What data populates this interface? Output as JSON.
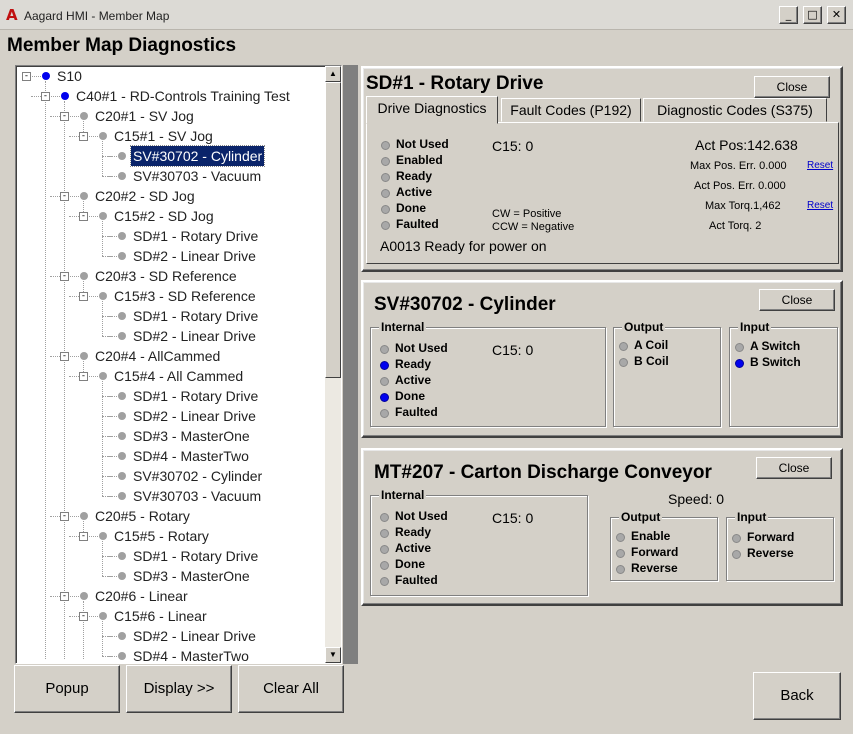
{
  "window": {
    "title": "Aagard HMI - Member Map",
    "icon": "app-a-icon",
    "min": "_",
    "max": "□",
    "close": "✕"
  },
  "page_title": "Member Map Diagnostics",
  "tree": [
    {
      "label": "S10",
      "level": 0,
      "dot": "blue",
      "expander": "-"
    },
    {
      "label": "C40#1 - RD-Controls Training Test",
      "level": 1,
      "dot": "blue",
      "expander": "-"
    },
    {
      "label": "C20#1 - SV Jog",
      "level": 2,
      "dot": "gray",
      "expander": "-"
    },
    {
      "label": "C15#1 - SV Jog",
      "level": 3,
      "dot": "gray",
      "expander": "-"
    },
    {
      "label": "SV#30702 - Cylinder",
      "level": 4,
      "dot": "gray",
      "selected": true
    },
    {
      "label": "SV#30703 - Vacuum",
      "level": 4,
      "dot": "gray"
    },
    {
      "label": "C20#2 - SD Jog",
      "level": 2,
      "dot": "gray",
      "expander": "-"
    },
    {
      "label": "C15#2 - SD Jog",
      "level": 3,
      "dot": "gray",
      "expander": "-"
    },
    {
      "label": "SD#1 - Rotary Drive",
      "level": 4,
      "dot": "gray"
    },
    {
      "label": "SD#2 - Linear Drive",
      "level": 4,
      "dot": "gray"
    },
    {
      "label": "C20#3 - SD Reference",
      "level": 2,
      "dot": "gray",
      "expander": "-"
    },
    {
      "label": "C15#3 - SD Reference",
      "level": 3,
      "dot": "gray",
      "expander": "-"
    },
    {
      "label": "SD#1 - Rotary Drive",
      "level": 4,
      "dot": "gray"
    },
    {
      "label": "SD#2 - Linear Drive",
      "level": 4,
      "dot": "gray"
    },
    {
      "label": "C20#4 - AllCammed",
      "level": 2,
      "dot": "gray",
      "expander": "-"
    },
    {
      "label": "C15#4 - All Cammed",
      "level": 3,
      "dot": "gray",
      "expander": "-"
    },
    {
      "label": "SD#1 - Rotary Drive",
      "level": 4,
      "dot": "gray"
    },
    {
      "label": "SD#2 - Linear Drive",
      "level": 4,
      "dot": "gray"
    },
    {
      "label": "SD#3 - MasterOne",
      "level": 4,
      "dot": "gray"
    },
    {
      "label": "SD#4 - MasterTwo",
      "level": 4,
      "dot": "gray"
    },
    {
      "label": "SV#30702 - Cylinder",
      "level": 4,
      "dot": "gray"
    },
    {
      "label": "SV#30703 - Vacuum",
      "level": 4,
      "dot": "gray"
    },
    {
      "label": "C20#5 - Rotary",
      "level": 2,
      "dot": "gray",
      "expander": "-"
    },
    {
      "label": "C15#5 - Rotary",
      "level": 3,
      "dot": "gray",
      "expander": "-"
    },
    {
      "label": "SD#1 - Rotary Drive",
      "level": 4,
      "dot": "gray"
    },
    {
      "label": "SD#3 - MasterOne",
      "level": 4,
      "dot": "gray"
    },
    {
      "label": "C20#6 - Linear",
      "level": 2,
      "dot": "gray",
      "expander": "-"
    },
    {
      "label": "C15#6 - Linear",
      "level": 3,
      "dot": "gray",
      "expander": "-"
    },
    {
      "label": "SD#2 - Linear Drive",
      "level": 4,
      "dot": "gray"
    },
    {
      "label": "SD#4 - MasterTwo",
      "level": 4,
      "dot": "gray"
    }
  ],
  "scroll": {
    "up": "▲",
    "down": "▼"
  },
  "buttons": {
    "popup": "Popup",
    "display": "Display >>",
    "clear_all": "Clear All",
    "back": "Back"
  },
  "sd_panel": {
    "title": "SD#1 - Rotary Drive",
    "close": "Close",
    "tabs": [
      "Drive Diagnostics",
      "Fault Codes (P192)",
      "Diagnostic Codes (S375)"
    ],
    "active_tab": 0,
    "status": [
      {
        "label": "Not Used",
        "on": false
      },
      {
        "label": "Enabled",
        "on": false
      },
      {
        "label": "Ready",
        "on": false
      },
      {
        "label": "Active",
        "on": false
      },
      {
        "label": "Done",
        "on": false
      },
      {
        "label": "Faulted",
        "on": false
      }
    ],
    "c15": "C15:  0",
    "cw": "CW = Positive",
    "ccw": "CCW = Negative",
    "message": "A0013 Ready for power on",
    "act_pos": "Act Pos:142.638",
    "max_pos_err": "Max Pos. Err. 0.000",
    "act_pos_err": "Act Pos. Err. 0.000",
    "max_torq": "Max Torq.1,462",
    "act_torq": "Act Torq. 2",
    "reset": "Reset"
  },
  "sv_panel": {
    "title": "SV#30702 - Cylinder",
    "close": "Close",
    "internal_label": "Internal",
    "internal": [
      {
        "label": "Not Used",
        "on": false
      },
      {
        "label": "Ready",
        "on": true
      },
      {
        "label": "Active",
        "on": false
      },
      {
        "label": "Done",
        "on": true
      },
      {
        "label": "Faulted",
        "on": false
      }
    ],
    "c15": "C15:  0",
    "output_label": "Output",
    "outputs": [
      {
        "label": "A Coil",
        "on": false
      },
      {
        "label": "B Coil",
        "on": false
      }
    ],
    "input_label": "Input",
    "inputs": [
      {
        "label": "A Switch",
        "on": false
      },
      {
        "label": "B Switch",
        "on": true
      }
    ]
  },
  "mt_panel": {
    "title": "MT#207 - Carton Discharge Conveyor",
    "close": "Close",
    "internal_label": "Internal",
    "internal": [
      {
        "label": "Not Used",
        "on": false
      },
      {
        "label": "Ready",
        "on": false
      },
      {
        "label": "Active",
        "on": false
      },
      {
        "label": "Done",
        "on": false
      },
      {
        "label": "Faulted",
        "on": false
      }
    ],
    "c15": "C15:  0",
    "speed": "Speed:  0",
    "output_label": "Output",
    "outputs": [
      {
        "label": "Enable",
        "on": false
      },
      {
        "label": "Forward",
        "on": false
      },
      {
        "label": "Reverse",
        "on": false
      }
    ],
    "input_label": "Input",
    "inputs": [
      {
        "label": "Forward",
        "on": false
      },
      {
        "label": "Reverse",
        "on": false
      }
    ]
  },
  "colors": {
    "led_on": "#0000ee",
    "led_off": "#a8a8a8",
    "selection": "#0a246a",
    "splitter": "#7f7f7f"
  }
}
